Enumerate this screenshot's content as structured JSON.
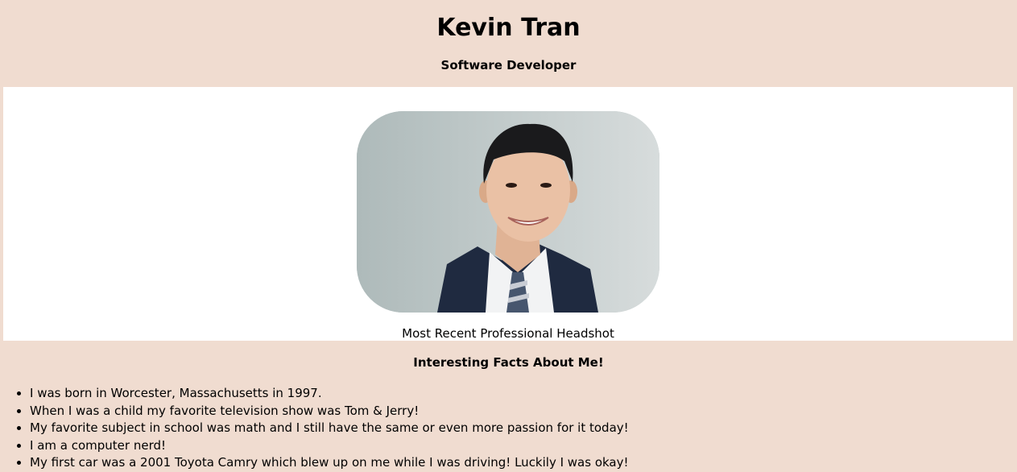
{
  "header": {
    "name": "Kevin Tran",
    "role": "Software Developer"
  },
  "photo": {
    "caption": "Most Recent Professional Headshot"
  },
  "facts": {
    "title": "Interesting Facts About Me!",
    "items": [
      "I was born in Worcester, Massachusetts in 1997.",
      "When I was a child my favorite television show was Tom & Jerry!",
      "My favorite subject in school was math and I still have the same or even more passion for it today!",
      "I am a computer nerd!",
      "My first car was a 2001 Toyota Camry which blew up on me while I was driving! Luckily I was okay!"
    ]
  },
  "colors": {
    "page_background": "#f0dcd0",
    "panel_background": "#ffffff"
  }
}
